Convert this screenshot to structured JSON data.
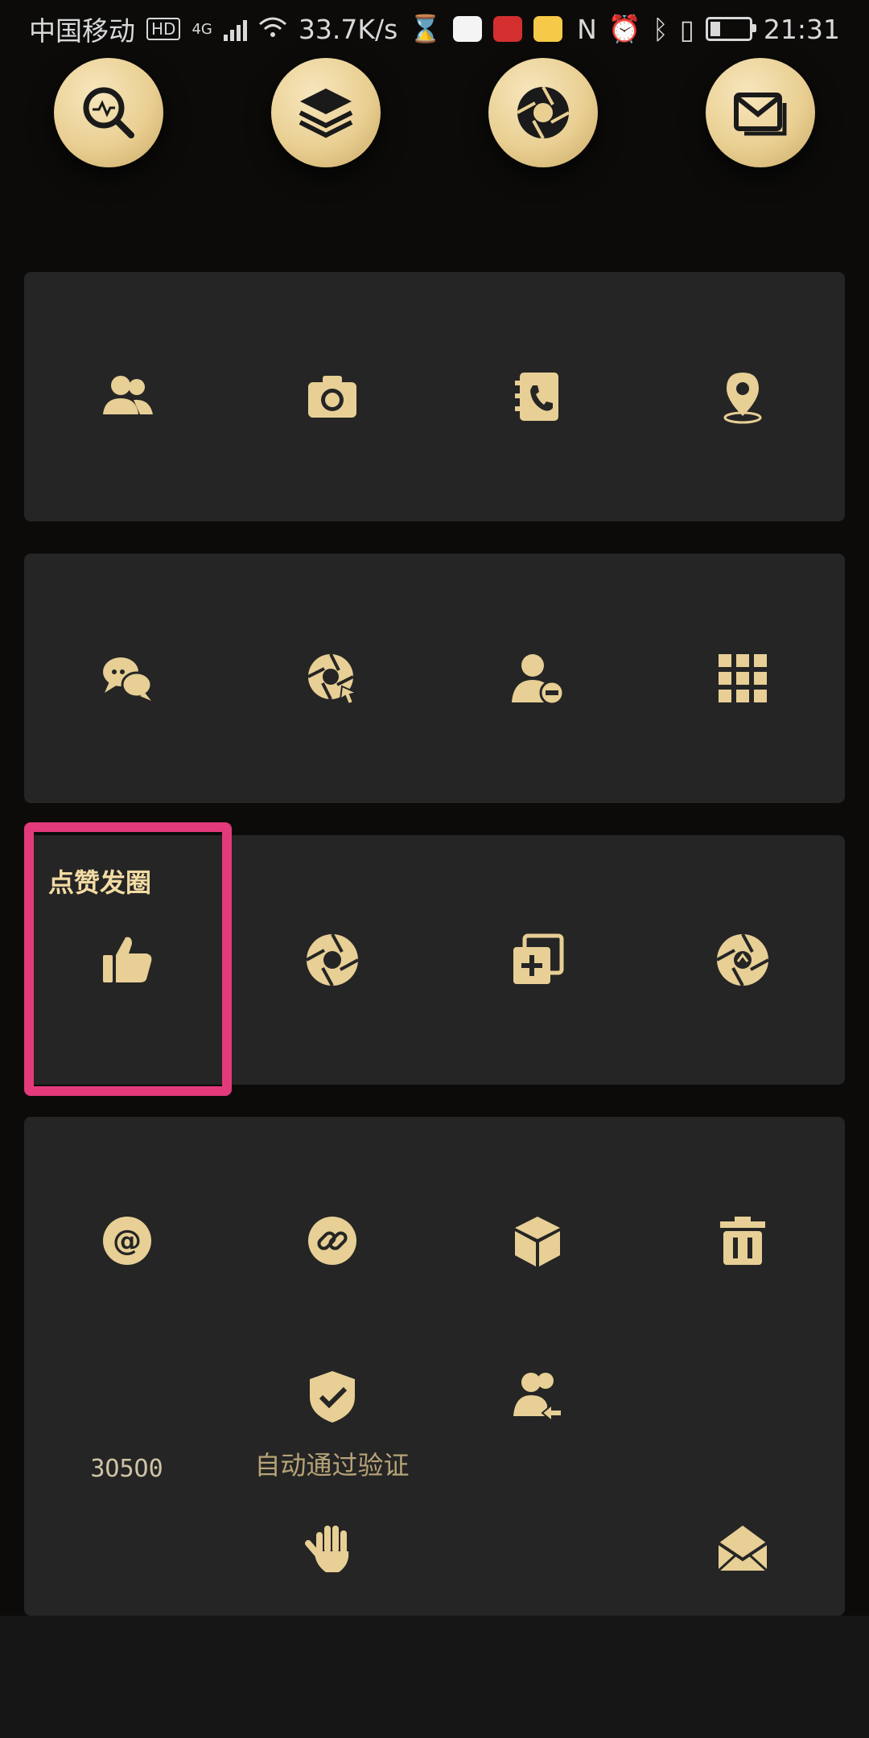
{
  "status_bar": {
    "carrier": "中国移动",
    "hd_badge": "HD",
    "network": "4G",
    "speed": "33.7K/s",
    "time": "21:31"
  },
  "top_icons": [
    {
      "name": "search-chart-icon"
    },
    {
      "name": "layers-icon"
    },
    {
      "name": "aperture-icon"
    },
    {
      "name": "mail-icon"
    }
  ],
  "panels": [
    {
      "row": "contacts",
      "items": [
        {
          "icon": "contacts-group-icon"
        },
        {
          "icon": "camera-icon"
        },
        {
          "icon": "phone-book-icon"
        },
        {
          "icon": "location-pin-icon"
        }
      ]
    },
    {
      "row": "chat",
      "items": [
        {
          "icon": "chat-bubbles-icon"
        },
        {
          "icon": "aperture-cursor-icon"
        },
        {
          "icon": "user-minus-icon"
        },
        {
          "icon": "grid-icon"
        }
      ]
    },
    {
      "row": "moments",
      "title": "点赞发圈",
      "items": [
        {
          "icon": "thumbs-up-icon"
        },
        {
          "icon": "aperture-icon"
        },
        {
          "icon": "duplicate-add-icon"
        },
        {
          "icon": "aperture-share-icon"
        }
      ]
    }
  ],
  "last_panel": {
    "items": [
      {
        "icon": "at-icon"
      },
      {
        "icon": "link-icon"
      },
      {
        "icon": "box-icon"
      },
      {
        "icon": "trash-icon"
      },
      {
        "icon": "shield-check-icon",
        "label": "自动通过验证"
      },
      {
        "icon": "user-arrow-icon"
      },
      {
        "icon": "hand-icon"
      },
      {
        "icon": "open-mail-icon"
      }
    ],
    "side_text": "3O5O0"
  },
  "colors": {
    "background": "#0c0b0a",
    "panel": "#252525",
    "gold": "#e7cf95",
    "highlight": "#e33a7b"
  }
}
